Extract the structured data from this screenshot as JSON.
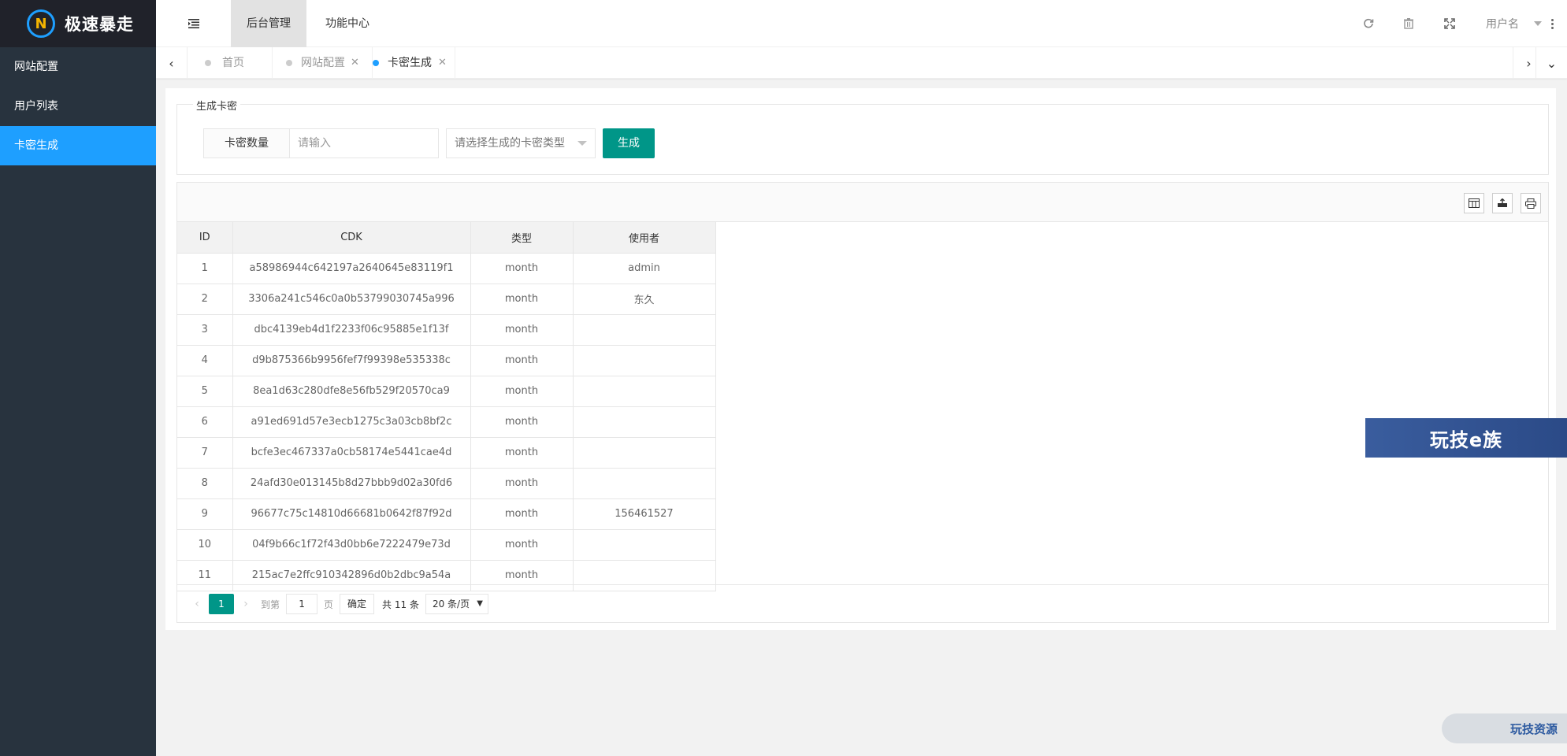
{
  "brand": {
    "name": "极速暴走",
    "logo_letter": "N"
  },
  "sidebar": {
    "items": [
      {
        "label": "网站配置"
      },
      {
        "label": "用户列表"
      },
      {
        "label": "卡密生成"
      }
    ]
  },
  "header": {
    "menu_icon": "menu-fold-icon",
    "tabs": [
      {
        "label": "后台管理"
      },
      {
        "label": "功能中心"
      }
    ],
    "icons": [
      "refresh-icon",
      "trash-icon",
      "fullscreen-icon"
    ],
    "user_name": "用户名"
  },
  "page_tabs": [
    {
      "label": "首页"
    },
    {
      "label": "网站配置"
    },
    {
      "label": "卡密生成"
    }
  ],
  "generate_form": {
    "legend": "生成卡密",
    "count_label": "卡密数量",
    "count_placeholder": "请输入",
    "type_placeholder": "请选择生成的卡密类型",
    "submit_label": "生成"
  },
  "table": {
    "toolbar_icons": [
      "columns-icon",
      "export-icon",
      "print-icon"
    ],
    "columns": [
      "ID",
      "CDK",
      "类型",
      "使用者"
    ],
    "rows": [
      [
        "1",
        "a58986944c642197a2640645e83119f1",
        "month",
        "admin"
      ],
      [
        "2",
        "3306a241c546c0a0b53799030745a996",
        "month",
        "东久"
      ],
      [
        "3",
        "dbc4139eb4d1f2233f06c95885e1f13f",
        "month",
        ""
      ],
      [
        "4",
        "d9b875366b9956fef7f99398e535338c",
        "month",
        ""
      ],
      [
        "5",
        "8ea1d63c280dfe8e56fb529f20570ca9",
        "month",
        ""
      ],
      [
        "6",
        "a91ed691d57e3ecb1275c3a03cb8bf2c",
        "month",
        ""
      ],
      [
        "7",
        "bcfe3ec467337a0cb58174e5441cae4d",
        "month",
        ""
      ],
      [
        "8",
        "24afd30e013145b8d27bbb9d02a30fd6",
        "month",
        ""
      ],
      [
        "9",
        "96677c75c14810d66681b0642f87f92d",
        "month",
        "156461527"
      ],
      [
        "10",
        "04f9b66c1f72f43d0bb6e7222479e73d",
        "month",
        ""
      ],
      [
        "11",
        "215ac7e2ffc910342896d0b2dbc9a54a",
        "month",
        ""
      ]
    ]
  },
  "pager": {
    "current": "1",
    "goto_label": "到第",
    "goto_value": "1",
    "page_unit": "页",
    "confirm_label": "确定",
    "total": "共 11 条",
    "page_size": "20 条/页"
  },
  "watermarks": {
    "banner": "玩技e族",
    "pill": "玩技资源"
  },
  "colors": {
    "primary": "#009688",
    "accent": "#1e9fff",
    "sidebar": "#28333e"
  }
}
